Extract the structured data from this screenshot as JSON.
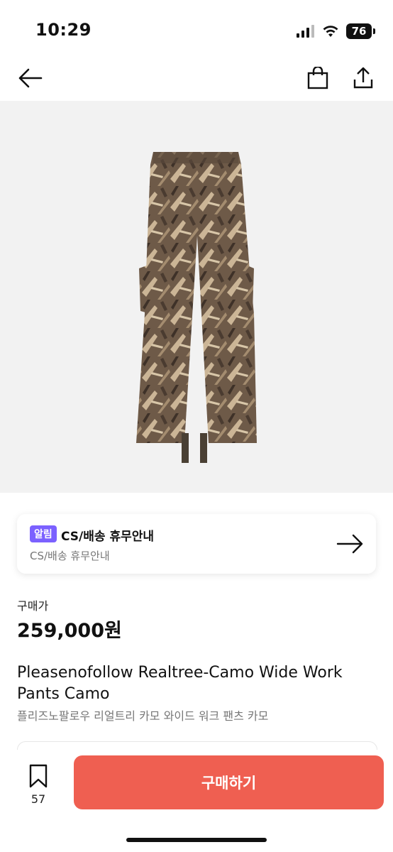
{
  "status_bar": {
    "time": "10:29",
    "battery": "76"
  },
  "notice": {
    "badge": "알림",
    "title": "CS/배송 휴무안내",
    "subtitle": "CS/배송 휴무안내"
  },
  "price": {
    "label": "구매가",
    "value": "259,000원"
  },
  "product": {
    "name": "Pleasenofollow Realtree-Camo Wide Work Pants Camo",
    "name_korean": "플리즈노팔로우 리얼트리 카모 와이드 워크 팬츠 카모",
    "image_icon": "camo-cargo-pants-image"
  },
  "bottom_bar": {
    "wish_count": "57",
    "buy_label": "구매하기"
  },
  "colors": {
    "buy_button": "#ef5f51",
    "badge": "#7b61ff",
    "hero_bg": "#f2f2f2"
  }
}
